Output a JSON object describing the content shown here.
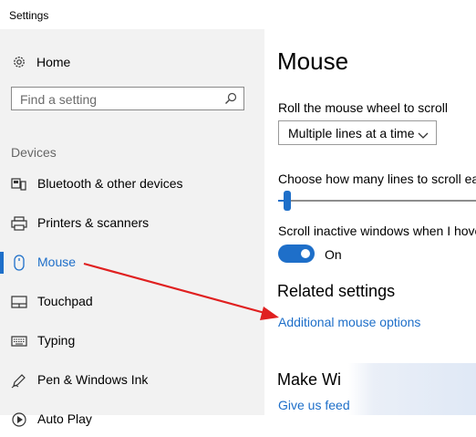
{
  "window": {
    "title": "Settings"
  },
  "sidebar": {
    "home_label": "Home",
    "search_placeholder": "Find a setting",
    "section": "Devices",
    "items": [
      {
        "label": "Bluetooth & other devices",
        "icon": "bluetooth-devices-icon"
      },
      {
        "label": "Printers & scanners",
        "icon": "printer-icon"
      },
      {
        "label": "Mouse",
        "icon": "mouse-icon",
        "active": true
      },
      {
        "label": "Touchpad",
        "icon": "touchpad-icon"
      },
      {
        "label": "Typing",
        "icon": "keyboard-icon"
      },
      {
        "label": "Pen & Windows Ink",
        "icon": "pen-icon"
      },
      {
        "label": "Auto Play",
        "icon": "autoplay-icon"
      }
    ]
  },
  "main": {
    "title": "Mouse",
    "scroll_wheel_label": "Roll the mouse wheel to scroll",
    "scroll_wheel_value": "Multiple lines at a time",
    "lines_label": "Choose how many lines to scroll each",
    "lines_slider_fraction": 0.03,
    "inactive_label": "Scroll inactive windows when I hover",
    "inactive_state": "On",
    "related_title": "Related settings",
    "related_link": "Additional mouse options",
    "make_title": "Make Wi",
    "feedback_link": "Give us feed"
  },
  "colors": {
    "accent": "#1e6fc9",
    "sidebar_bg": "#f2f2f2",
    "annotation_arrow": "#e02020"
  }
}
